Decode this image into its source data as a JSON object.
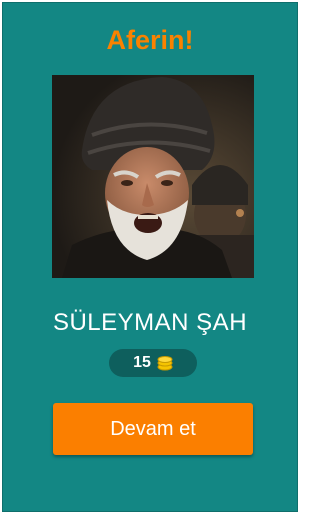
{
  "result": {
    "title": "Aferin!"
  },
  "answer": {
    "name": "SÜLEYMAN ŞAH"
  },
  "coins": {
    "count": "15",
    "icon": "coin-stack-icon"
  },
  "actions": {
    "continue_label": "Devam et"
  },
  "colors": {
    "background": "#138784",
    "title": "#f98200",
    "button": "#fb7f00",
    "badge": "#0e5f5d",
    "coin": "#f5c400"
  }
}
